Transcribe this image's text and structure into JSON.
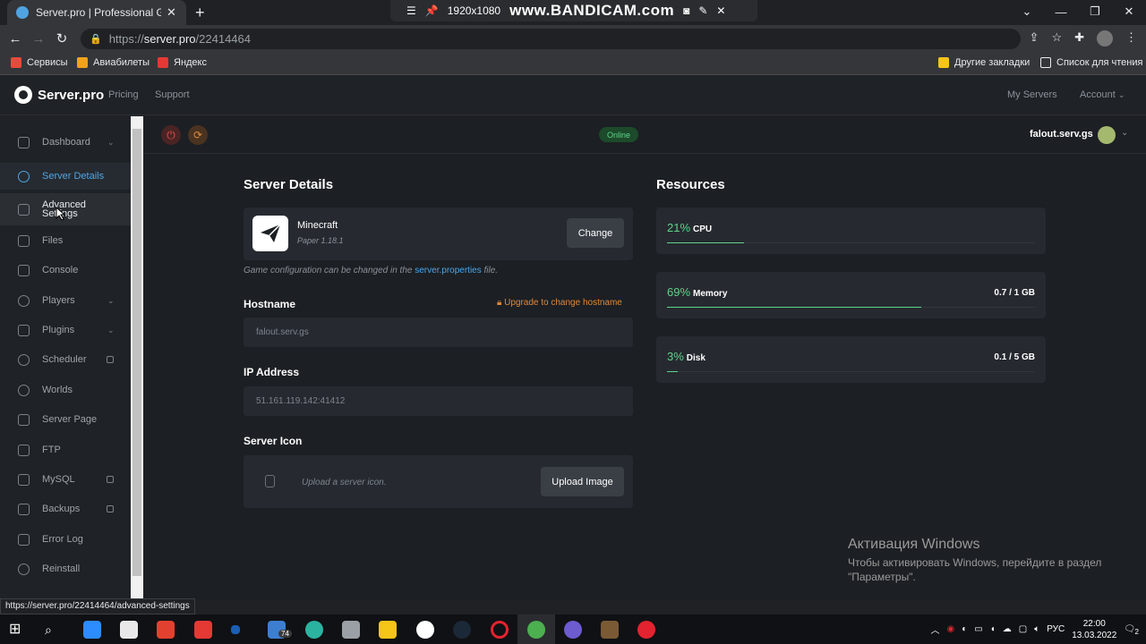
{
  "browser": {
    "tab_title": "Server.pro | Professional Game S",
    "url_prefix": "https://",
    "url_host": "server.pro",
    "url_path": "/22414464",
    "status_url": "https://server.pro/22414464/advanced-settings",
    "bandicam": {
      "resolution": "1920x1080",
      "brand": "www.BANDICAM.com"
    },
    "bookmarks": [
      {
        "label": "Сервисы",
        "color": "#e64a3b"
      },
      {
        "label": "Авиабилеты",
        "color": "#f2a21b"
      },
      {
        "label": "Яндекс",
        "color": "#e53935"
      }
    ],
    "bookmarks_right": [
      {
        "label": "Другие закладки"
      },
      {
        "label": "Список для чтения"
      }
    ]
  },
  "site": {
    "logo_text": "Server.pro",
    "nav": [
      "Pricing",
      "Support"
    ],
    "nav_right": [
      "My Servers",
      "Account"
    ]
  },
  "sidebar": {
    "items": [
      {
        "label": "Dashboard",
        "icon": "dashboard-icon",
        "chevron": true
      },
      {
        "label": "Server Details",
        "icon": "gear-icon",
        "active": true
      },
      {
        "label": "Advanced Settings",
        "icon": "sliders-icon"
      },
      {
        "label": "Files",
        "icon": "folder-icon"
      },
      {
        "label": "Console",
        "icon": "terminal-icon"
      },
      {
        "label": "Players",
        "icon": "user-icon",
        "chevron": true
      },
      {
        "label": "Plugins",
        "icon": "puzzle-icon",
        "chevron": true
      },
      {
        "label": "Scheduler",
        "icon": "clock-icon",
        "lock": true
      },
      {
        "label": "Worlds",
        "icon": "globe-icon"
      },
      {
        "label": "Server Page",
        "icon": "page-icon"
      },
      {
        "label": "FTP",
        "icon": "upload-icon"
      },
      {
        "label": "MySQL",
        "icon": "database-icon",
        "lock": true
      },
      {
        "label": "Backups",
        "icon": "archive-icon",
        "lock": true
      },
      {
        "label": "Error Log",
        "icon": "log-icon"
      },
      {
        "label": "Reinstall",
        "icon": "refresh-icon"
      }
    ]
  },
  "topbar": {
    "status": "Online",
    "server_name": "falout.serv.gs",
    "colors": {
      "power": "#e0534a",
      "restart": "#e0883a"
    }
  },
  "details": {
    "title": "Server Details",
    "game_name": "Minecraft",
    "game_version": "Paper 1.18.1",
    "change_label": "Change",
    "note_prefix": "Game configuration can be changed in the ",
    "note_link": "server.properties",
    "note_suffix": " file.",
    "hostname_label": "Hostname",
    "hostname_upgrade": "Upgrade to change hostname",
    "hostname_value": "falout.serv.gs",
    "ip_label": "IP Address",
    "ip_value": "51.161.119.142:41412",
    "icon_label": "Server Icon",
    "icon_placeholder": "Upload a server icon.",
    "upload_label": "Upload Image"
  },
  "resources": {
    "title": "Resources",
    "items": [
      {
        "pct": "21%",
        "label": "CPU",
        "value": "",
        "fill": 0.21
      },
      {
        "pct": "69%",
        "label": "Memory",
        "value": "0.7 / 1 GB",
        "fill": 0.69
      },
      {
        "pct": "3%",
        "label": "Disk",
        "value": "0.1 / 5 GB",
        "fill": 0.03
      }
    ]
  },
  "watermark": {
    "title": "Активация Windows",
    "line1": "Чтобы активировать Windows, перейдите в раздел",
    "line2": "\"Параметры\"."
  },
  "taskbar": {
    "badge": "74",
    "lang": "РУС",
    "time": "22:00",
    "date": "13.03.2022",
    "notif_count": "2"
  }
}
